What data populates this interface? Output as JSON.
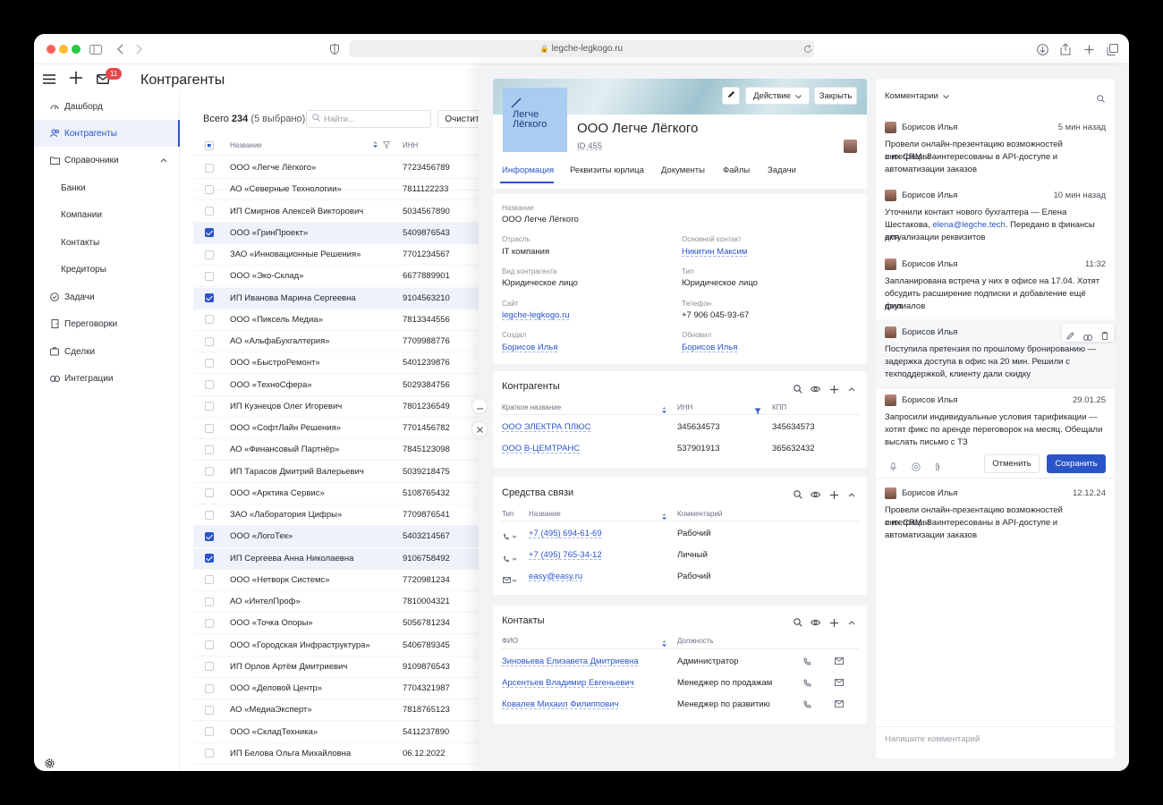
{
  "browser": {
    "url": "legche-legkogo.ru"
  },
  "header": {
    "title": "Контрагенты",
    "mail_badge": "11"
  },
  "sidebar": {
    "items": [
      {
        "label": "Дашборд",
        "icon": "dashboard-icon"
      },
      {
        "label": "Контрагенты",
        "icon": "users-icon"
      },
      {
        "label": "Справочники",
        "icon": "folder-icon"
      },
      {
        "label": "Банки"
      },
      {
        "label": "Компании"
      },
      {
        "label": "Контакты"
      },
      {
        "label": "Кредиторы"
      },
      {
        "label": "Задачи",
        "icon": "check-circle-icon"
      },
      {
        "label": "Переговорки",
        "icon": "door-icon"
      },
      {
        "label": "Сделки",
        "icon": "handshake-icon"
      },
      {
        "label": "Интеграции",
        "icon": "link-icon"
      }
    ]
  },
  "list": {
    "total_label": "Всего",
    "total_count": "234",
    "selected_note": "(5 выбрано)",
    "search_placeholder": "Найти...",
    "clear_button": "Очистить",
    "col_name": "Название",
    "col_inn": "ИНН",
    "rows": [
      {
        "name": "ООО «Легче Лёгкого»",
        "inn": "7723456789",
        "checked": false
      },
      {
        "name": "АО «Северные Технологии»",
        "inn": "7811122233",
        "checked": false
      },
      {
        "name": "ИП Смирнов Алексей Викторович",
        "inn": "5034567890",
        "checked": false
      },
      {
        "name": "ООО «ГринПроект»",
        "inn": "5409876543",
        "checked": true
      },
      {
        "name": "ЗАО «Инновационные Решения»",
        "inn": "7701234567",
        "checked": false
      },
      {
        "name": "ООО «Эко-Склад»",
        "inn": "6677889901",
        "checked": false
      },
      {
        "name": "ИП Иванова Марина Сергеевна",
        "inn": "9104563210",
        "checked": true
      },
      {
        "name": "ООО «Пиксель Медиа»",
        "inn": "7813344556",
        "checked": false
      },
      {
        "name": "АО «АльфаБухгалтерия»",
        "inn": "7709988776",
        "checked": false
      },
      {
        "name": "ООО «БыстроРемонт»",
        "inn": "5401239876",
        "checked": false
      },
      {
        "name": "ООО «ТехноСфера»",
        "inn": "5029384756",
        "checked": false
      },
      {
        "name": "ИП Кузнецов Олег Игоревич",
        "inn": "7801236549",
        "checked": false
      },
      {
        "name": "ООО «СофтЛайн Решения»",
        "inn": "7701456782",
        "checked": false
      },
      {
        "name": "АО «Финансовый Партнёр»",
        "inn": "7845123098",
        "checked": false
      },
      {
        "name": "ИП Тарасов Дмитрий Валерьевич",
        "inn": "5039218475",
        "checked": false
      },
      {
        "name": "ООО «Арктика Сервис»",
        "inn": "5108765432",
        "checked": false
      },
      {
        "name": "ЗАО «Лаборатория Цифры»",
        "inn": "7709876541",
        "checked": false
      },
      {
        "name": "ООО «ЛогоТек»",
        "inn": "5403214567",
        "checked": true
      },
      {
        "name": "ИП Сергеева Анна Николаевна",
        "inn": "9106758492",
        "checked": true
      },
      {
        "name": "ООО «Нетворк Системс»",
        "inn": "7720981234",
        "checked": false
      },
      {
        "name": "АО «ИнтелПроф»",
        "inn": "7810004321",
        "checked": false
      },
      {
        "name": "ООО «Точка Опоры»",
        "inn": "5056781234",
        "checked": false
      },
      {
        "name": "ООО «Городская Инфраструктура»",
        "inn": "5406789345",
        "checked": false
      },
      {
        "name": "ИП Орлов Артём Дмитриевич",
        "inn": "9109876543",
        "checked": false
      },
      {
        "name": "ООО «Деловой Центр»",
        "inn": "7704321987",
        "checked": false
      },
      {
        "name": "АО «МедиаЭксперт»",
        "inn": "7818765123",
        "checked": false
      },
      {
        "name": "ООО «СкладТехника»",
        "inn": "5411237890",
        "checked": false
      },
      {
        "name": "ИП Белова Ольга Михайловна",
        "inn": "06.12.2022",
        "checked": false
      }
    ]
  },
  "card": {
    "logo_text_line1": "Легче",
    "logo_text_line2": "Лёгкого",
    "company_name": "ООО Легче Лёгкого",
    "id_label": "ID 455",
    "action_button": "Действие",
    "close_button": "Закрыть",
    "tabs": [
      "Информация",
      "Реквизиты юрлица",
      "Документы",
      "Файлы",
      "Задачи"
    ],
    "info": {
      "name_label": "Название",
      "name_value": "ООО Легче Лёгкого",
      "industry_label": "Отрасль",
      "industry_value": "IT компания",
      "contact_label": "Основной контакт",
      "contact_value": "Никитин Максим",
      "kind_label": "Вид контрагента",
      "kind_value": "Юридическое лицо",
      "type_label": "Тип",
      "type_value": "Юридическое лицо",
      "site_label": "Сайт",
      "site_value": "legche-legkogo.ru",
      "phone_label": "Телефон",
      "phone_value": "+7 906 045-93-67",
      "created_label": "Создал",
      "created_value": "Борисов Илья",
      "updated_label": "Обновил",
      "updated_value": "Борисов Илья"
    },
    "contractors": {
      "title": "Контрагенты",
      "col_short": "Краткое название",
      "col_inn": "ИНН",
      "col_kpp": "КПП",
      "rows": [
        {
          "name": "ООО ЭЛЕКТРА ПЛЮС",
          "inn": "345634573",
          "kpp": "345634573"
        },
        {
          "name": "ООО В-ЦЕМТРАНС",
          "inn": "537901913",
          "kpp": "365632432"
        }
      ]
    },
    "comms": {
      "title": "Средства связи",
      "col_type": "Тип",
      "col_name": "Название",
      "col_comment": "Комментарий",
      "rows": [
        {
          "icon": "phone-icon",
          "value": "+7 (495) 694-61-69",
          "comment": "Рабочий"
        },
        {
          "icon": "phone-icon",
          "value": "+7 (495) 765-34-12",
          "comment": "Личный"
        },
        {
          "icon": "mail-icon",
          "value": "easy@easy.ru",
          "comment": "Рабочий"
        }
      ]
    },
    "contacts": {
      "title": "Контакты",
      "col_fio": "ФИО",
      "col_position": "Должность",
      "rows": [
        {
          "name": "Зиновьева Елизавета Дмитриевна",
          "position": "Администратор"
        },
        {
          "name": "Арсентьев Владимир Евгеньевич",
          "position": "Менеджер по продажам"
        },
        {
          "name": "Ковалев Михаил Филиппович",
          "position": "Менеджер по развитию"
        }
      ]
    }
  },
  "comments": {
    "title": "Комментарии",
    "cancel": "Отменить",
    "save": "Сохранить",
    "placeholder": "Напишите комментарий",
    "items": [
      {
        "author": "Борисов Илья",
        "time": "5 мин назад",
        "lines": [
          "Провели онлайн-презентацию возможностей интеграции",
          "с их CRM. Заинтересованы в API-доступе и",
          "автоматизации заказов"
        ]
      },
      {
        "author": "Борисов Илья",
        "time": "10 мин назад",
        "lines": [
          "Уточнили контакт нового бухгалтера — Елена",
          "Шестакова, elena@legche.tech. Передано в финансы для",
          "актуализации реквизитов"
        ]
      },
      {
        "author": "Борисов Илья",
        "time": "11:32",
        "lines": [
          "Запланирована встреча у них в офисе на 17.04. Хотят",
          "обсудить расширение подписки и добавление ещё двух",
          "филиалов"
        ]
      },
      {
        "author": "Борисов Илья",
        "time": "",
        "lines": [
          "Поступила претензия по прошлому бронированию —",
          "задержка доступа в офис на 20 мин. Решили с",
          "техподдержкой, клиенту дали скидку"
        ]
      },
      {
        "author": "Борисов Илья",
        "time": "29.01.25",
        "lines": [
          "Запросили индивидуальные условия тарификации —",
          "хотят фикс по аренде переговорок на месяц. Обещали",
          "выслать письмо с ТЗ"
        ]
      },
      {
        "author": "Борисов Илья",
        "time": "12.12.24",
        "lines": [
          "Провели онлайн-презентацию возможностей интеграции",
          "с их CRM. Заинтересованы в API-доступе и",
          "автоматизации заказов"
        ]
      }
    ]
  },
  "colors": {
    "accent": "#2a55c9",
    "badge": "#e5484d"
  }
}
